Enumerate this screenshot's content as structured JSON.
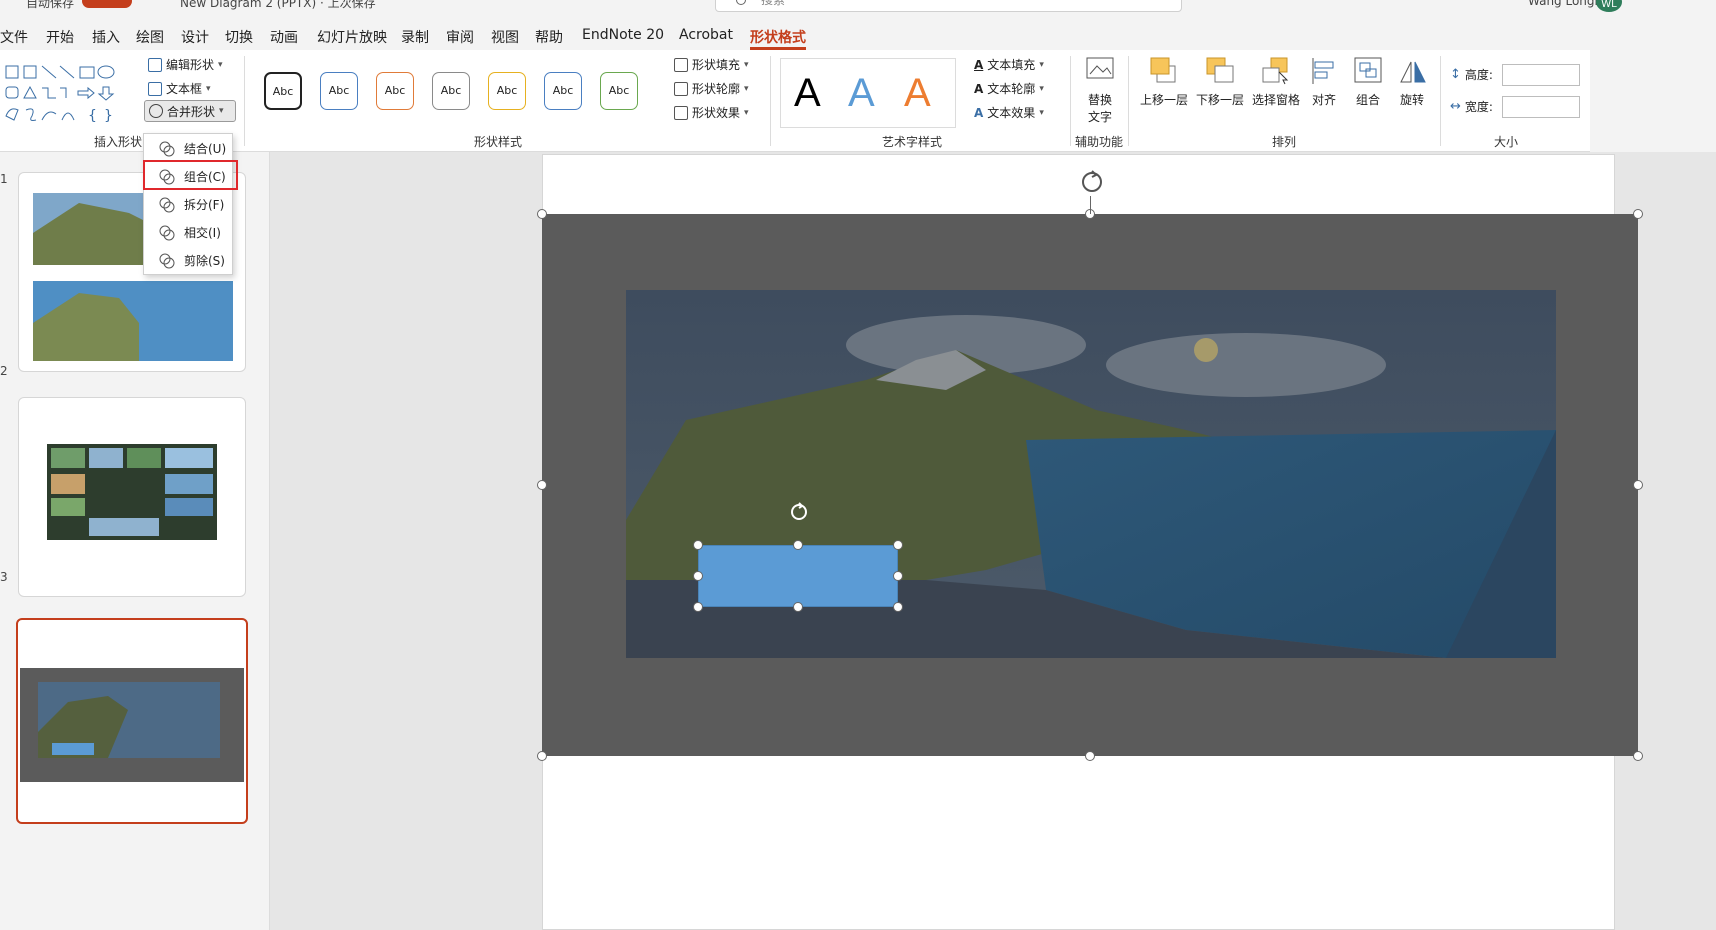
{
  "titlebar": {
    "autosave": "自动保存",
    "toggle": "开",
    "doc_title": "New Diagram 2 (PPTX) · 上次保存",
    "search_placeholder": "搜索",
    "user": "Wang Longhao",
    "avatar_initials": "WL"
  },
  "menu": {
    "tabs": [
      "文件",
      "开始",
      "插入",
      "绘图",
      "设计",
      "切换",
      "动画",
      "幻灯片放映",
      "录制",
      "审阅",
      "视图",
      "帮助",
      "EndNote 20",
      "Acrobat",
      "形状格式"
    ],
    "active": "形状格式"
  },
  "ribbon": {
    "insert_shapes": {
      "label": "插入形状",
      "edit_shape": "编辑形状",
      "text_box": "文本框",
      "merge_shapes": "合并形状"
    },
    "shape_styles": {
      "label": "形状样式",
      "sample_text": "Abc",
      "style_colors": [
        "#222222",
        "#4a7fc1",
        "#e07b39",
        "#8a8a8a",
        "#e6b120",
        "#4a7fc1",
        "#6aa84f"
      ],
      "fill": "形状填充",
      "outline": "形状轮廓",
      "effects": "形状效果"
    },
    "wordart": {
      "label": "艺术字样式",
      "letter": "A",
      "colors": [
        "#000000",
        "#5b9bd5",
        "#ed7d31"
      ],
      "text_fill": "文本填充",
      "text_outline": "文本轮廓",
      "text_effects": "文本效果"
    },
    "accessibility": {
      "label": "辅助功能",
      "alt_text_line1": "替换",
      "alt_text_line2": "文字"
    },
    "arrange": {
      "label": "排列",
      "bring_forward": "上移一层",
      "send_backward": "下移一层",
      "selection_pane": "选择窗格",
      "align": "对齐",
      "group": "组合",
      "rotate": "旋转"
    },
    "size": {
      "label": "大小",
      "height": "高度:",
      "width": "宽度:"
    }
  },
  "merge_menu": {
    "items": [
      "结合(U)",
      "组合(C)",
      "拆分(F)",
      "相交(I)",
      "剪除(S)"
    ],
    "highlighted": "组合(C)"
  },
  "thumbnails": {
    "numbers": [
      "1",
      "2",
      "3"
    ],
    "selected": 3
  },
  "colors": {
    "accent": "#c43e1c",
    "overlay": "#5b5b5b",
    "shape_fill": "#5b9bd5",
    "highlight": "#e0282c"
  }
}
